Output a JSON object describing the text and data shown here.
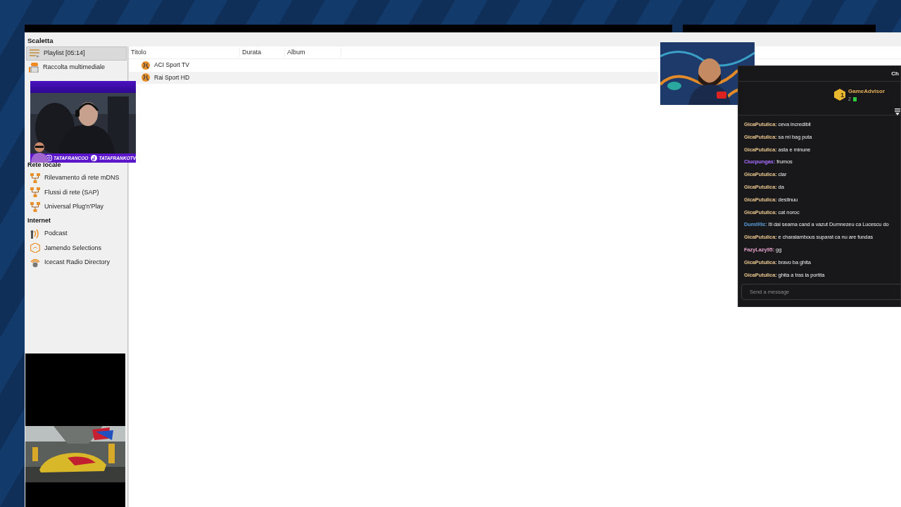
{
  "sidebar": {
    "title": "Scaletta",
    "sections": [
      {
        "items": [
          {
            "label": "Playlist [05:14]",
            "kind": "playlist",
            "selected": true
          },
          {
            "label": "Raccolta multimediale",
            "kind": "library",
            "selected": false
          }
        ]
      },
      {
        "heading": "Rete locale",
        "items": [
          {
            "label": "Rilevamento di rete mDNS",
            "kind": "network",
            "selected": false
          },
          {
            "label": "Flussi di rete (SAP)",
            "kind": "network",
            "selected": false
          },
          {
            "label": "Universal Plug'n'Play",
            "kind": "network",
            "selected": false
          }
        ]
      },
      {
        "heading": "Internet",
        "items": [
          {
            "label": "Podcast",
            "kind": "podcast",
            "selected": false
          },
          {
            "label": "Jamendo Selections",
            "kind": "jamendo",
            "selected": false
          },
          {
            "label": "Icecast Radio Directory",
            "kind": "icecast",
            "selected": false
          }
        ]
      }
    ]
  },
  "playlist": {
    "columns": [
      "Titolo",
      "Durata",
      "Album"
    ],
    "rows": [
      {
        "title": "ACI Sport TV",
        "selected": false
      },
      {
        "title": "Rai Sport HD",
        "selected": true
      }
    ]
  },
  "webcam": {
    "handles": [
      {
        "kind": "instagram",
        "text": "TATAFRANCOO"
      },
      {
        "kind": "tiktok",
        "text": "TATAFRANKOTV"
      }
    ]
  },
  "chat": {
    "title": "Ch",
    "leader": {
      "rank": "1",
      "name": "GameAdvisor",
      "count": "2"
    },
    "messages": [
      {
        "user": "GicaPutulica:",
        "color": "#e6c38c",
        "text": "ceva incredibil"
      },
      {
        "user": "GicaPutulica:",
        "color": "#e6c38c",
        "text": "sa mi bag puta"
      },
      {
        "user": "GicaPutulica:",
        "color": "#e6c38c",
        "text": "asta e minune"
      },
      {
        "user": "Ciucpungas:",
        "color": "#a970ff",
        "text": "frumos"
      },
      {
        "user": "GicaPutulica:",
        "color": "#e6c38c",
        "text": "clar"
      },
      {
        "user": "GicaPutulica:",
        "color": "#e6c38c",
        "text": "da"
      },
      {
        "user": "GicaPutulica:",
        "color": "#e6c38c",
        "text": "destinuu"
      },
      {
        "user": "GicaPutulica:",
        "color": "#e6c38c",
        "text": "cat noroc"
      },
      {
        "user": "Dumi99z:",
        "color": "#5b9bd5",
        "text": "Iti dai seama cand a vazut Dumnezeu ca Lucescu do"
      },
      {
        "user": "GicaPutulica:",
        "color": "#e6c38c",
        "text": "e charalambous suparat ca nu are fundas"
      },
      {
        "user": "FazyLazy95:",
        "color": "#e3a0c8",
        "text": "gg"
      },
      {
        "user": "GicaPutulica:",
        "color": "#e6c38c",
        "text": "bravo ba ghita"
      },
      {
        "user": "GicaPutulica:",
        "color": "#e6c38c",
        "text": "ghita a tras la portita"
      }
    ],
    "input": {
      "placeholder": "Send a message"
    }
  }
}
